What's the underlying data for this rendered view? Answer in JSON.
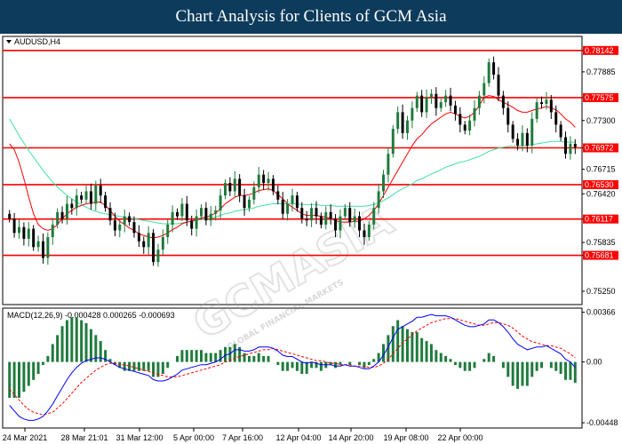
{
  "header": {
    "title": "Chart Analysis for Clients of GCM Asia"
  },
  "chart_data": {
    "type": "candlestick",
    "symbol": "AUDUSD,H4",
    "watermark": "GCMASIA",
    "watermark_sub": "GLOBAL FINANCIAL MARKETS",
    "ylim": [
      0.751,
      0.783
    ],
    "y_ticks": [
      0.78142,
      0.77885,
      0.77575,
      0.773,
      0.76972,
      0.76715,
      0.7642,
      0.76117,
      0.75835,
      0.75681,
      0.7525
    ],
    "y_tick_labels": [
      "0.78142",
      "0.77885",
      "0.77575",
      "0.77300",
      "0.76972",
      "0.76715",
      "0.76420",
      "0.76117",
      "0.75835",
      "0.75681",
      "0.75250"
    ],
    "x_labels": [
      "24 Mar 2021",
      "28 Mar 21:01",
      "31 Mar 12:00",
      "5 Apr 00:00",
      "7 Apr 16:00",
      "12 Apr 04:00",
      "14 Apr 20:00",
      "19 Apr 08:00",
      "22 Apr 00:00"
    ],
    "levels": [
      {
        "value": 0.78142,
        "label": "0.78142"
      },
      {
        "value": 0.77575,
        "label": "0.77575"
      },
      {
        "value": 0.76972,
        "label": "0.76972"
      },
      {
        "value": 0.7653,
        "label": "0.76530"
      },
      {
        "value": 0.76117,
        "label": "0.76117"
      },
      {
        "value": 0.75681,
        "label": "0.75681"
      }
    ],
    "level_color": "#ff0000",
    "bull_color": "#1e7b3c",
    "bear_color": "#000000",
    "ma_fast_color": "#ff0000",
    "ma_slow_color": "#40e0a0",
    "close": [
      0.7612,
      0.7595,
      0.7602,
      0.7588,
      0.76,
      0.7578,
      0.7585,
      0.7565,
      0.759,
      0.7605,
      0.762,
      0.7612,
      0.763,
      0.7625,
      0.764,
      0.7635,
      0.7645,
      0.763,
      0.7652,
      0.764,
      0.7625,
      0.761,
      0.7598,
      0.7605,
      0.7615,
      0.7608,
      0.7595,
      0.7585,
      0.7578,
      0.7595,
      0.756,
      0.7575,
      0.759,
      0.7605,
      0.762,
      0.7615,
      0.763,
      0.761,
      0.76,
      0.7615,
      0.7625,
      0.761,
      0.7618,
      0.7622,
      0.764,
      0.7655,
      0.7645,
      0.766,
      0.764,
      0.7625,
      0.7635,
      0.765,
      0.7665,
      0.7655,
      0.766,
      0.7645,
      0.7635,
      0.7618,
      0.763,
      0.764,
      0.7625,
      0.7612,
      0.761,
      0.7625,
      0.7615,
      0.7605,
      0.762,
      0.7612,
      0.7598,
      0.7615,
      0.7625,
      0.7608,
      0.7615,
      0.7598,
      0.759,
      0.7605,
      0.7625,
      0.7645,
      0.7665,
      0.769,
      0.772,
      0.774,
      0.7715,
      0.773,
      0.7745,
      0.776,
      0.774,
      0.7758,
      0.7762,
      0.7745,
      0.7752,
      0.776,
      0.7748,
      0.7738,
      0.7725,
      0.7718,
      0.773,
      0.7745,
      0.776,
      0.7775,
      0.78,
      0.7785,
      0.776,
      0.7745,
      0.7725,
      0.7708,
      0.77,
      0.7715,
      0.77,
      0.7732,
      0.7752,
      0.775,
      0.7755,
      0.774,
      0.7725,
      0.771,
      0.769,
      0.7702,
      0.7698
    ],
    "ma_fast": [
      0.7702,
      0.7695,
      0.768,
      0.766,
      0.7638,
      0.7618,
      0.7605,
      0.76,
      0.7598,
      0.76,
      0.7605,
      0.7612,
      0.7618,
      0.7622,
      0.7626,
      0.7628,
      0.763,
      0.7631,
      0.7632,
      0.7632,
      0.7628,
      0.7622,
      0.7615,
      0.7609,
      0.7605,
      0.7601,
      0.7598,
      0.7594,
      0.7592,
      0.759,
      0.7589,
      0.759,
      0.7592,
      0.7595,
      0.7599,
      0.7602,
      0.7606,
      0.7608,
      0.7609,
      0.7611,
      0.7613,
      0.7614,
      0.7616,
      0.7619,
      0.7624,
      0.763,
      0.7634,
      0.7638,
      0.764,
      0.764,
      0.7641,
      0.7643,
      0.7646,
      0.7647,
      0.7648,
      0.7646,
      0.7641,
      0.7636,
      0.763,
      0.7626,
      0.7622,
      0.7618,
      0.7616,
      0.7616,
      0.7616,
      0.7615,
      0.7614,
      0.7612,
      0.761,
      0.7608,
      0.7608,
      0.7608,
      0.7609,
      0.7609,
      0.7612,
      0.7616,
      0.7622,
      0.763,
      0.764,
      0.765,
      0.766,
      0.767,
      0.768,
      0.769,
      0.77,
      0.7708,
      0.7713,
      0.772,
      0.7726,
      0.773,
      0.7734,
      0.7738,
      0.774,
      0.7738,
      0.7735,
      0.7733,
      0.7735,
      0.774,
      0.7748,
      0.7758,
      0.776,
      0.7759,
      0.7755,
      0.7752,
      0.7749,
      0.7746,
      0.7742,
      0.774,
      0.774,
      0.7742,
      0.7744,
      0.7745,
      0.7747,
      0.7745,
      0.7743,
      0.7738,
      0.7732,
      0.7728,
      0.7722
    ],
    "ma_slow": [
      0.7732,
      0.7722,
      0.7712,
      0.7703,
      0.7694,
      0.7686,
      0.7678,
      0.767,
      0.7663,
      0.7656,
      0.765,
      0.7645,
      0.764,
      0.7636,
      0.7632,
      0.7629,
      0.7626,
      0.7623,
      0.7621,
      0.7619,
      0.7618,
      0.7617,
      0.7616,
      0.7615,
      0.7614,
      0.7613,
      0.7612,
      0.7611,
      0.761,
      0.7609,
      0.7608,
      0.7607,
      0.7606,
      0.7606,
      0.7606,
      0.7606,
      0.7607,
      0.7608,
      0.7609,
      0.761,
      0.7611,
      0.7612,
      0.7613,
      0.7614,
      0.7616,
      0.7618,
      0.7619,
      0.7621,
      0.7622,
      0.7623,
      0.7624,
      0.7625,
      0.7627,
      0.7628,
      0.7629,
      0.763,
      0.763,
      0.763,
      0.763,
      0.763,
      0.763,
      0.7629,
      0.7629,
      0.7629,
      0.7629,
      0.7628,
      0.7628,
      0.7628,
      0.7627,
      0.7627,
      0.7627,
      0.7627,
      0.7627,
      0.7627,
      0.7627,
      0.7628,
      0.7629,
      0.7631,
      0.7634,
      0.7637,
      0.7641,
      0.7645,
      0.7648,
      0.7651,
      0.7654,
      0.7658,
      0.766,
      0.7663,
      0.7666,
      0.7668,
      0.7671,
      0.7674,
      0.7676,
      0.7678,
      0.768,
      0.7681,
      0.7683,
      0.7685,
      0.7687,
      0.769,
      0.7693,
      0.7695,
      0.7697,
      0.7698,
      0.7699,
      0.7699,
      0.7699,
      0.77,
      0.77,
      0.7701,
      0.7702,
      0.7703,
      0.7704,
      0.7705,
      0.7705,
      0.7705,
      0.7704,
      0.7704,
      0.7704
    ],
    "macd": {
      "label": "MACD(12,26,9) -0.000428 0.000265 -0.000693",
      "ylim": [
        -0.0048,
        0.0039
      ],
      "y_ticks": [
        0.00366,
        0.0,
        -0.00448
      ],
      "y_tick_labels": [
        "0.00366",
        "0.00",
        "-0.00448"
      ],
      "macd_color": "#0000ff",
      "signal_color": "#ff0000",
      "hist_color": "#1e7b3c",
      "macd_line": [
        -0.0032,
        -0.0036,
        -0.004,
        -0.0042,
        -0.0043,
        -0.0043,
        -0.0042,
        -0.004,
        -0.0036,
        -0.0031,
        -0.0025,
        -0.0019,
        -0.0013,
        -0.0008,
        -0.0004,
        -0.0001,
        0.0001,
        0.0002,
        0.0003,
        0.0003,
        0.0002,
        0.0,
        -0.0002,
        -0.0004,
        -0.0005,
        -0.0006,
        -0.0007,
        -0.0008,
        -0.0009,
        -0.001,
        -0.0013,
        -0.0014,
        -0.0014,
        -0.0013,
        -0.0011,
        -0.0009,
        -0.0006,
        -0.0005,
        -0.0004,
        -0.0003,
        -0.0002,
        -0.0002,
        -0.0001,
        0.0,
        0.0002,
        0.0005,
        0.0006,
        0.0009,
        0.0009,
        0.0008,
        0.0008,
        0.0009,
        0.0011,
        0.0011,
        0.0011,
        0.001,
        0.0008,
        0.0005,
        0.0004,
        0.0004,
        0.0002,
        0.0,
        -0.0001,
        0.0,
        -0.0001,
        -0.0002,
        -0.0002,
        -0.0002,
        -0.0003,
        -0.0003,
        -0.0002,
        -0.0003,
        -0.0003,
        -0.0004,
        -0.0005,
        -0.0005,
        -0.0003,
        0.0,
        0.0005,
        0.0011,
        0.0018,
        0.0024,
        0.0026,
        0.0028,
        0.003,
        0.0033,
        0.0033,
        0.0034,
        0.0035,
        0.0034,
        0.0034,
        0.0034,
        0.0033,
        0.0031,
        0.0029,
        0.0027,
        0.0026,
        0.0026,
        0.0027,
        0.0028,
        0.0031,
        0.0031,
        0.0029,
        0.0026,
        0.0022,
        0.0017,
        0.0013,
        0.0011,
        0.0009,
        0.001,
        0.0011,
        0.0011,
        0.0012,
        0.001,
        0.0008,
        0.0006,
        0.0002,
        0.0,
        -0.0004
      ],
      "signal_line": [
        -0.002,
        -0.0024,
        -0.0028,
        -0.0032,
        -0.0035,
        -0.0037,
        -0.0038,
        -0.0039,
        -0.0038,
        -0.0037,
        -0.0034,
        -0.0031,
        -0.0027,
        -0.0023,
        -0.0019,
        -0.0015,
        -0.0012,
        -0.0009,
        -0.0006,
        -0.0004,
        -0.0002,
        -0.0001,
        -0.0001,
        -0.0002,
        -0.0002,
        -0.0003,
        -0.0004,
        -0.0005,
        -0.0006,
        -0.0007,
        -0.0008,
        -0.0009,
        -0.001,
        -0.0011,
        -0.0011,
        -0.0011,
        -0.001,
        -0.0009,
        -0.0008,
        -0.0007,
        -0.0006,
        -0.0005,
        -0.0004,
        -0.0003,
        -0.0002,
        0.0,
        0.0001,
        0.0003,
        0.0004,
        0.0005,
        0.0006,
        0.0007,
        0.0008,
        0.0009,
        0.0009,
        0.001,
        0.0009,
        0.0008,
        0.0007,
        0.0006,
        0.0005,
        0.0004,
        0.0003,
        0.0002,
        0.0001,
        0.0001,
        0.0,
        -0.0001,
        -0.0001,
        -0.0002,
        -0.0002,
        -0.0002,
        -0.0003,
        -0.0003,
        -0.0003,
        -0.0004,
        -0.0004,
        -0.0003,
        -0.0001,
        0.0002,
        0.0006,
        0.001,
        0.0014,
        0.0017,
        0.002,
        0.0023,
        0.0025,
        0.0027,
        0.0029,
        0.003,
        0.0031,
        0.0032,
        0.0032,
        0.0032,
        0.0031,
        0.003,
        0.0029,
        0.0028,
        0.0027,
        0.0027,
        0.0028,
        0.0029,
        0.0029,
        0.0028,
        0.0027,
        0.0025,
        0.0022,
        0.0019,
        0.0017,
        0.0015,
        0.0014,
        0.0013,
        0.0012,
        0.0012,
        0.0011,
        0.001,
        0.0008,
        0.0006,
        0.0003
      ]
    }
  }
}
